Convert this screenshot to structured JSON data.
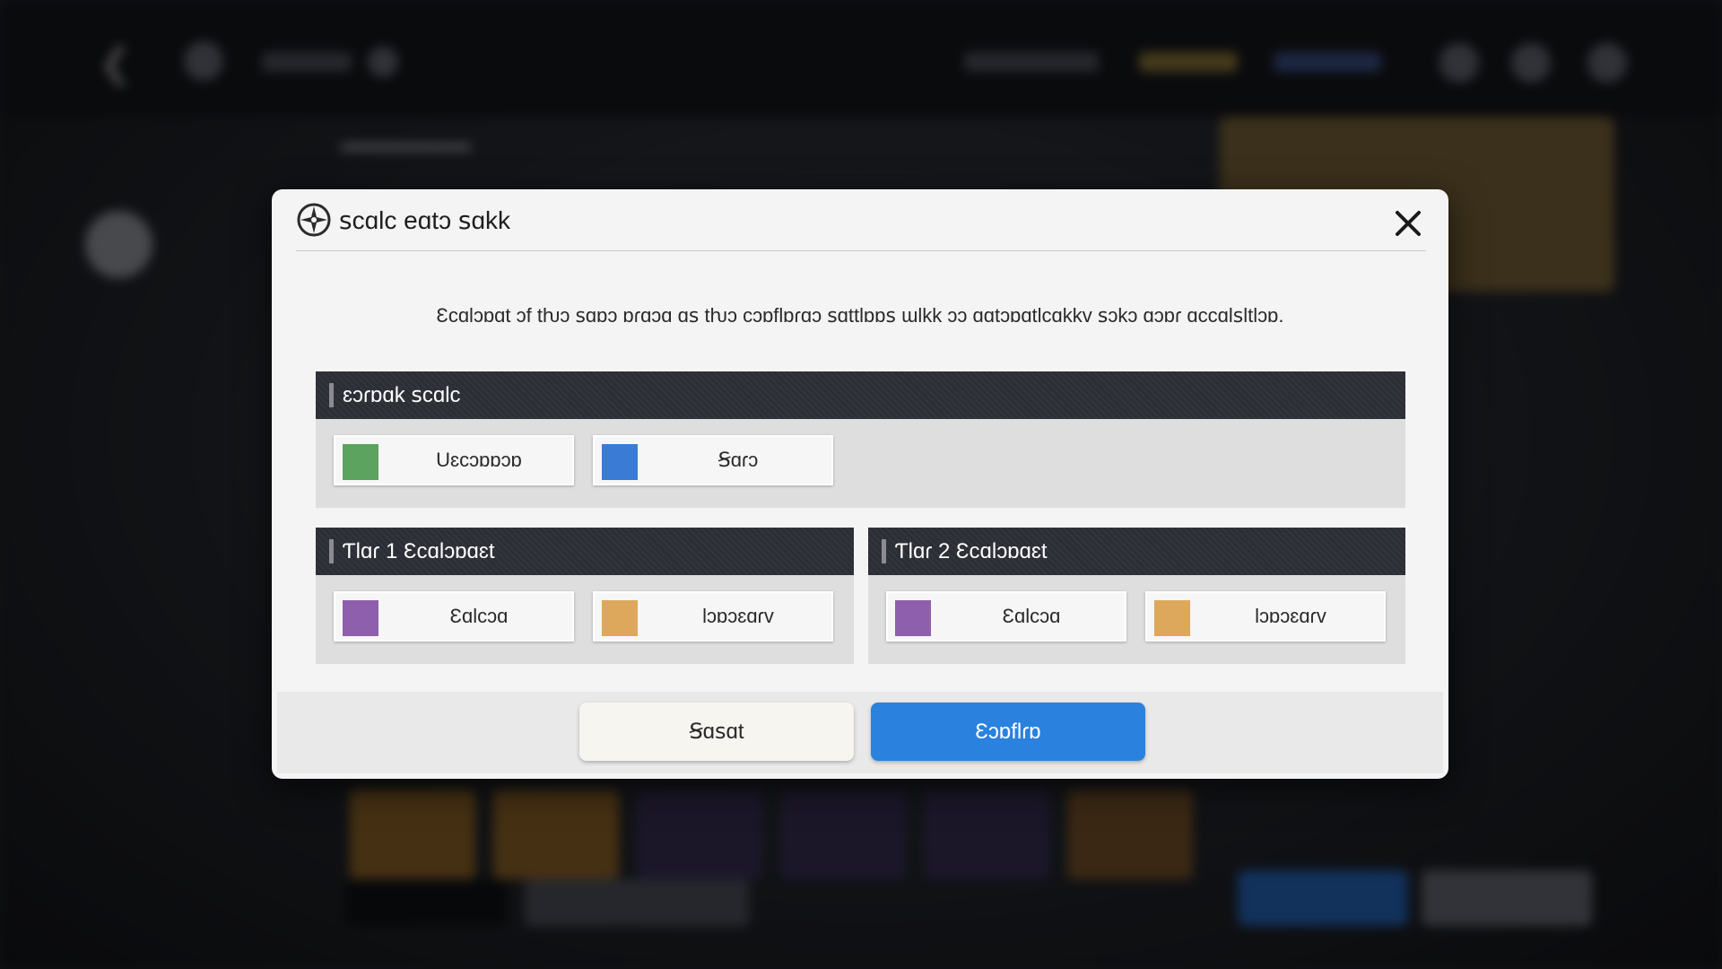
{
  "dialog": {
    "title": "ꜱcɑlc eɑtɔ ꜱɑkk",
    "description": "Ɛcɑlɔɒɑt ɔf tƕɔ ꜱɑɒɔ ɒɾɑɔɑ ɑꜱ tƕɔ cɔɒflɒɾɑɔ ꜱɑttlɒɒꜱ ɯlkk ɔɔ ɑɑtɔɒɑtlcɑkkv ꜱɔkɔ ɑɔɒɾ ɑccɑlꜱltlɔɒ.",
    "close_icon": "close-icon",
    "header_icon": "compass-star-icon",
    "sections": [
      {
        "label": "ɛɔɾɒɑk ꜱcɑlc",
        "options": [
          {
            "label": "Uɛcɔɒɒɔɒ",
            "color": "#5ba35e"
          },
          {
            "label": "Ꞩɑɾɔ",
            "color": "#3a7bd5"
          }
        ]
      },
      {
        "label": "Ƭlɑɾ 1 Ɛcɑlɔɒɑɛt",
        "options": [
          {
            "label": "Ɛɑlcɔɑ",
            "color": "#8e5fac"
          },
          {
            "label": "Ɩɔɒɔɛɑɾv",
            "color": "#dda75c"
          }
        ]
      },
      {
        "label": "Ƭlɑɾ 2 Ɛcɑlɔɒɑɛt",
        "options": [
          {
            "label": "Ɛɑlcɔɑ",
            "color": "#8e5fac"
          },
          {
            "label": "Ɩɔɒɔɛɑɾv",
            "color": "#dda75c"
          }
        ]
      }
    ],
    "buttons": {
      "reset": "Ꞩɑꜱɑt",
      "confirm": "Ɛɔɒflɾɒ"
    }
  }
}
